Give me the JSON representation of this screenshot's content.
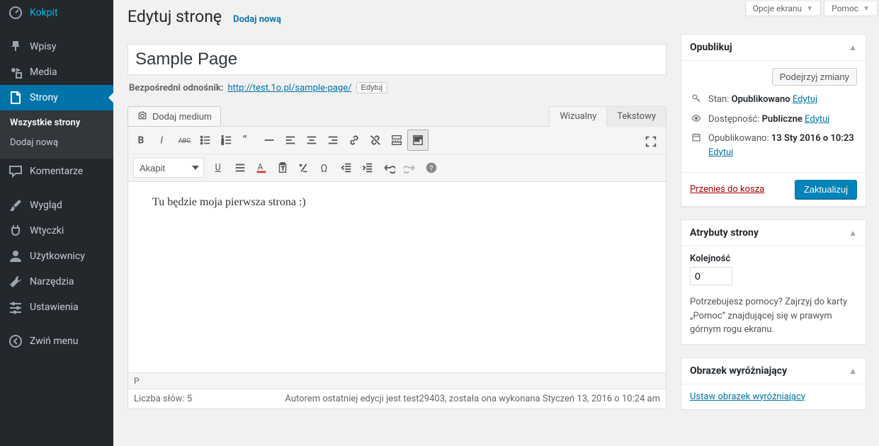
{
  "menu": {
    "items": [
      {
        "label": "Kokpit",
        "icon": "gauge"
      },
      {
        "label": "Wpisy",
        "icon": "pin"
      },
      {
        "label": "Media",
        "icon": "media"
      },
      {
        "label": "Strony",
        "icon": "page",
        "current": true
      },
      {
        "label": "Komentarze",
        "icon": "comment"
      },
      {
        "label": "Wygląd",
        "icon": "brush"
      },
      {
        "label": "Wtyczki",
        "icon": "plug"
      },
      {
        "label": "Użytkownicy",
        "icon": "user"
      },
      {
        "label": "Narzędzia",
        "icon": "wrench"
      },
      {
        "label": "Ustawienia",
        "icon": "toggles"
      },
      {
        "label": "Zwiń menu",
        "icon": "collapse"
      }
    ],
    "submenu": {
      "all": "Wszystkie strony",
      "add": "Dodaj nową"
    }
  },
  "screen_options": "Opcje ekranu",
  "help_tab": "Pomoc",
  "heading": "Edytuj stronę",
  "add_new": "Dodaj nową",
  "title_value": "Sample Page",
  "permalink": {
    "label": "Bezpośredni odnośnik:",
    "base": "http://test.1o.pl/",
    "slug": "sample-page/",
    "edit": "Edytuj"
  },
  "add_media": "Dodaj medium",
  "editor_tabs": {
    "visual": "Wizualny",
    "text": "Tekstowy"
  },
  "format_select": "Akapit",
  "editor_content": "Tu będzie moja pierwsza strona :)",
  "path": "P",
  "word_count_label": "Liczba słów:",
  "word_count": "5",
  "last_edit": "Autorem ostatniej edycji jest test29403, została ona wykonana Styczeń 13, 2016 o 10:24 am",
  "publish": {
    "title": "Opublikuj",
    "preview": "Podejrzyj zmiany",
    "status_label": "Stan:",
    "status_value": "Opublikowano",
    "edit": "Edytuj",
    "visibility_label": "Dostępność:",
    "visibility_value": "Publiczne",
    "published_label": "Opublikowano:",
    "published_value": "13 Sty 2016 o 10:23",
    "trash": "Przenieś do kosza",
    "update": "Zaktualizuj"
  },
  "attributes": {
    "title": "Atrybuty strony",
    "order_label": "Kolejność",
    "order_value": "0",
    "help": "Potrzebujesz pomocy? Zajrzyj do karty „Pomoc” znajdującej się w prawym górnym rogu ekranu."
  },
  "featured": {
    "title": "Obrazek wyróżniający",
    "link": "Ustaw obrazek wyróżniający"
  }
}
